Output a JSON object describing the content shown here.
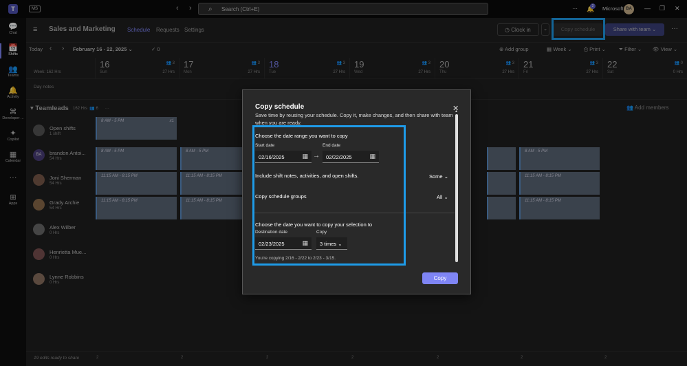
{
  "titlebar": {
    "ms_badge": "MS",
    "search_placeholder": "Search (Ctrl+E)",
    "more": "···",
    "notif_count": "2",
    "org": "Microsoft",
    "avatar": "BA",
    "minimize": "—",
    "restore": "❐",
    "close": "✕"
  },
  "rail": {
    "items": [
      {
        "label": "Chat",
        "icon": "chat-icon",
        "glyph": "💬"
      },
      {
        "label": "Shifts",
        "icon": "shifts-icon",
        "glyph": "📅"
      },
      {
        "label": "Teams",
        "icon": "teams-icon",
        "glyph": "👥"
      },
      {
        "label": "Activity",
        "icon": "bell-icon",
        "glyph": "🔔"
      },
      {
        "label": "Developer ...",
        "icon": "developer-icon",
        "glyph": "⌘"
      },
      {
        "label": "Copilot",
        "icon": "copilot-icon",
        "glyph": "✦"
      },
      {
        "label": "Calendar",
        "icon": "calendar-icon",
        "glyph": "▦"
      },
      {
        "label": "",
        "icon": "more-icon",
        "glyph": "···"
      },
      {
        "label": "Apps",
        "icon": "apps-icon",
        "glyph": "⊞"
      }
    ]
  },
  "header": {
    "team_name": "Sales and Marketing",
    "tabs": [
      "Schedule",
      "Requests",
      "Settings"
    ],
    "clock_in": "Clock in",
    "copy_schedule": "Copy schedule",
    "share": "Share with team"
  },
  "toolbar": {
    "today": "Today",
    "date_range": "February 16 - 22, 2025",
    "check_count": "0",
    "add_group": "Add group",
    "week": "Week",
    "print": "Print",
    "filter": "Filter",
    "view": "View"
  },
  "grid": {
    "week_hours": "Week: 162 Hrs",
    "day_notes": "Day notes",
    "days": [
      {
        "num": "16",
        "name": "Sun",
        "hrs": "27 Hrs",
        "ppl": "3"
      },
      {
        "num": "17",
        "name": "Mon",
        "hrs": "27 Hrs",
        "ppl": "3"
      },
      {
        "num": "18",
        "name": "Tue",
        "hrs": "27 Hrs",
        "ppl": "3"
      },
      {
        "num": "19",
        "name": "Wed",
        "hrs": "27 Hrs",
        "ppl": "3"
      },
      {
        "num": "20",
        "name": "Thu",
        "hrs": "27 Hrs",
        "ppl": "3"
      },
      {
        "num": "21",
        "name": "Fri",
        "hrs": "27 Hrs",
        "ppl": "3"
      },
      {
        "num": "22",
        "name": "Sat",
        "hrs": "0 Hrs",
        "ppl": "0"
      }
    ],
    "group": {
      "name": "Teamleads",
      "hours": "162 Hrs",
      "count": "6",
      "add_members": "Add members"
    },
    "members": [
      {
        "name": "Open shifts",
        "sub": "1 shift",
        "initials": ""
      },
      {
        "name": "brandon Antoi...",
        "sub": "54 Hrs",
        "initials": "BA"
      },
      {
        "name": "Joni Sherman",
        "sub": "54 Hrs",
        "initials": ""
      },
      {
        "name": "Grady Archie",
        "sub": "54 Hrs",
        "initials": ""
      },
      {
        "name": "Alex Wilber",
        "sub": "0 Hrs",
        "initials": ""
      },
      {
        "name": "Henrietta Mue...",
        "sub": "0 Hrs",
        "initials": ""
      },
      {
        "name": "Lynne Robbins",
        "sub": "0 Hrs",
        "initials": ""
      }
    ],
    "shift_labels": {
      "open": "8 AM - 5 PM",
      "day": "8 AM - 5 PM",
      "late": "11:15 AM - 8:15 PM",
      "open_count": "x1"
    }
  },
  "status": {
    "text": "19 edits ready to share",
    "marks": [
      "2",
      "2",
      "2",
      "2",
      "2",
      "2",
      "2"
    ]
  },
  "modal": {
    "title": "Copy schedule",
    "description": "Save time by reusing your schedule. Copy it, make changes, and then share with team when you are ready.",
    "date_range_title": "Choose the date range you want to copy",
    "start_label": "Start date",
    "start_value": "02/16/2025",
    "end_label": "End date",
    "end_value": "02/22/2025",
    "include_label": "Include shift notes, activities, and open shifts.",
    "include_value": "Some",
    "groups_label": "Copy schedule groups",
    "groups_value": "All",
    "dest_title": "Choose the date you want to copy your selection to",
    "dest_label": "Destination date",
    "dest_value": "02/23/2025",
    "copies_label": "Copy",
    "copies_value": "3 times",
    "summary": "You're copying 2/16 - 2/22 to 2/23 - 3/15.",
    "copy_button": "Copy"
  },
  "colors": {
    "accent": "#7f85f5",
    "highlight": "#1e9be8",
    "shift": "#5a6675"
  }
}
